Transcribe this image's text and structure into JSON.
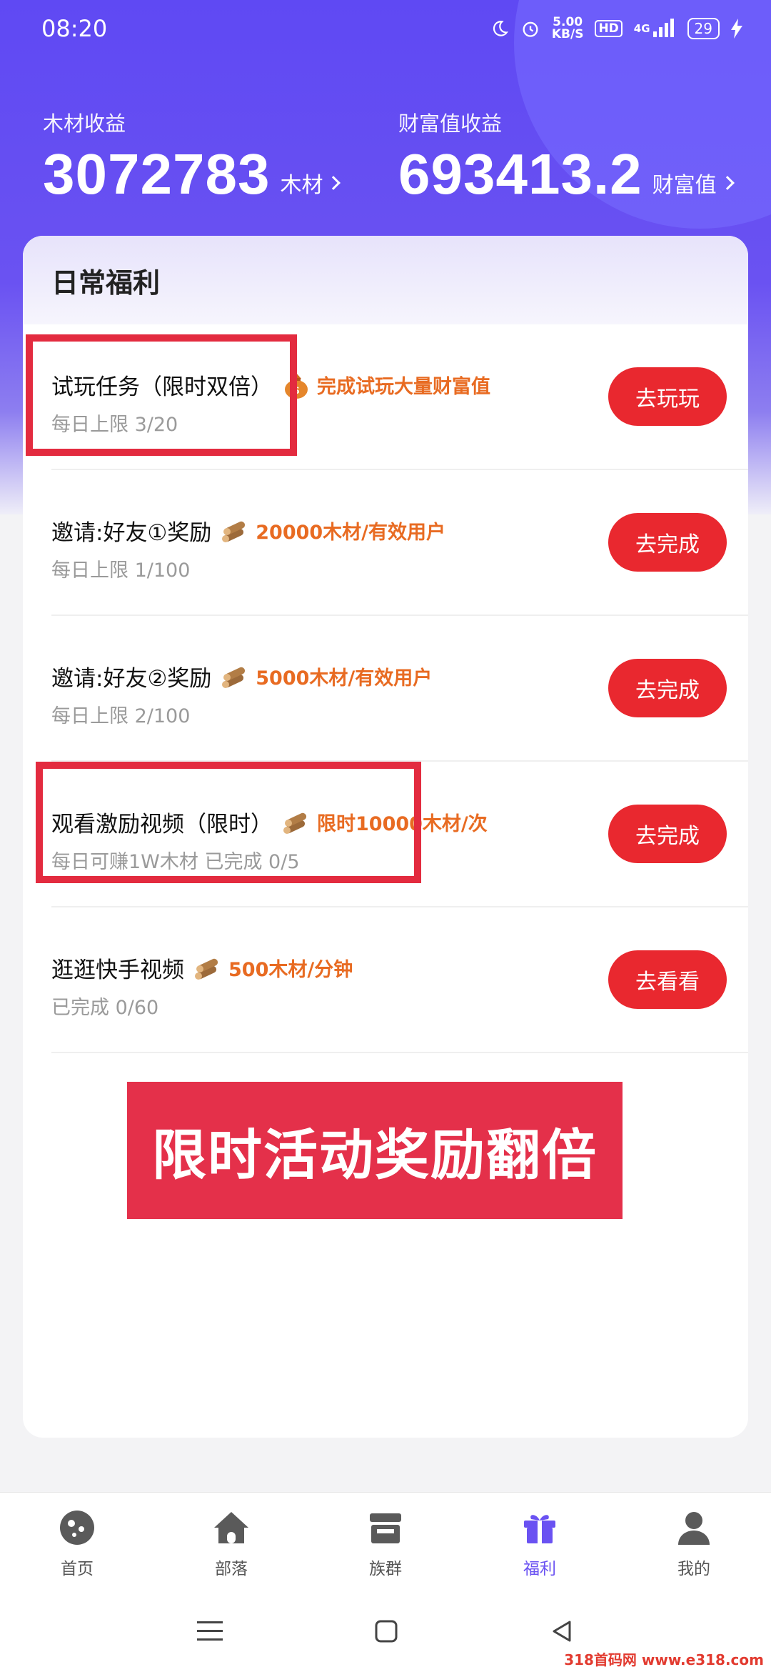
{
  "status_bar": {
    "time": "08:20",
    "net_speed_value": "5.00",
    "net_speed_unit": "KB/S",
    "hd": "HD",
    "network": "4G",
    "battery": "29"
  },
  "earnings": {
    "wood_label": "木材收益",
    "wood_value": "3072783",
    "wood_unit": "木材",
    "wealth_label": "财富值收益",
    "wealth_value": "693413.2",
    "wealth_unit": "财富值"
  },
  "card": {
    "title": "日常福利",
    "tasks": [
      {
        "title": "试玩任务（限时双倍）",
        "reward": "完成试玩大量财富值",
        "reward_icon": "money-bag-icon",
        "sub": "每日上限 3/20",
        "button": "去玩玩"
      },
      {
        "title": "邀请:好友①奖励",
        "reward": "20000木材/有效用户",
        "reward_icon": "wood-logs-icon",
        "sub": "每日上限 1/100",
        "button": "去完成"
      },
      {
        "title": "邀请:好友②奖励",
        "reward": "5000木材/有效用户",
        "reward_icon": "wood-logs-icon",
        "sub": "每日上限 2/100",
        "button": "去完成"
      },
      {
        "title": "观看激励视频（限时）",
        "reward": "限时10000木材/次",
        "reward_icon": "wood-logs-icon",
        "sub": "每日可赚1W木材 已完成 0/5",
        "button": "去完成"
      },
      {
        "title": "逛逛快手视频",
        "reward": "500木材/分钟",
        "reward_icon": "wood-logs-icon",
        "sub": "已完成 0/60",
        "button": "去看看"
      }
    ]
  },
  "promo_banner": "限时活动奖励翻倍",
  "tabbar": [
    {
      "label": "首页",
      "icon": "planet-icon"
    },
    {
      "label": "部落",
      "icon": "house-icon"
    },
    {
      "label": "族群",
      "icon": "store-icon"
    },
    {
      "label": "福利",
      "icon": "gift-icon"
    },
    {
      "label": "我的",
      "icon": "user-icon"
    }
  ],
  "active_tab": "福利",
  "watermark": "318首码网 www.e318.com",
  "colors": {
    "brand_purple": "#6a52f2",
    "button_red": "#e9282f",
    "reward_orange": "#e86b22",
    "highlight_red": "#e32b3f"
  }
}
